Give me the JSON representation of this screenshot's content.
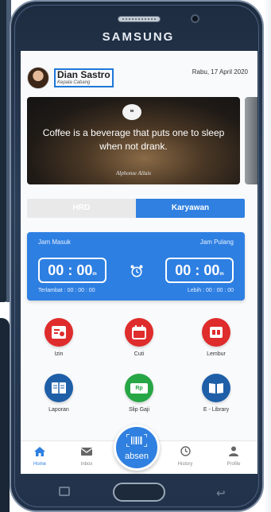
{
  "device": {
    "brand": "SAMSUNG"
  },
  "header": {
    "user_name": "Dian Sastro",
    "user_role": "Kepala Cabang",
    "date": "Rabu, 17 April 2020"
  },
  "quote": {
    "text": "Coffee is a beverage that puts one to sleep when not drank.",
    "author": "Alphonse Allais"
  },
  "tabs": [
    {
      "label": "HRD",
      "active": false
    },
    {
      "label": "Karyawan",
      "active": true
    }
  ],
  "attendance": {
    "in_label": "Jam Masuk",
    "out_label": "Jam Pulang",
    "in_time": "00 : 00",
    "in_suffix": "m",
    "out_time": "00 : 00",
    "out_suffix": "m",
    "late": "Terlambat : 00 : 00 : 00",
    "overtime": "Lebih : 00 : 00 : 00"
  },
  "menu": [
    {
      "label": "Izin",
      "icon": "permit-icon",
      "color": "#df2c2c"
    },
    {
      "label": "Cuti",
      "icon": "calendar-icon",
      "color": "#df2c2c"
    },
    {
      "label": "Lembur",
      "icon": "overtime-icon",
      "color": "#df2c2c"
    },
    {
      "label": "Laporan",
      "icon": "report-icon",
      "color": "#1e5fa8"
    },
    {
      "label": "Slip Gaji",
      "icon": "payslip-icon",
      "color": "#27a645",
      "badge": "Rp"
    },
    {
      "label": "E - Library",
      "icon": "book-icon",
      "color": "#1e5fa8"
    }
  ],
  "nav": [
    {
      "label": "Home",
      "icon": "home-icon",
      "active": true
    },
    {
      "label": "Inbox",
      "icon": "mail-icon",
      "active": false
    },
    {
      "label": "History",
      "icon": "clock-icon",
      "active": false
    },
    {
      "label": "Profile",
      "icon": "user-icon",
      "active": false
    }
  ],
  "absen": {
    "label": "absen",
    "icon": "barcode-icon"
  },
  "colors": {
    "primary": "#2f80e0",
    "red": "#df2c2c",
    "navy": "#1e5fa8",
    "green": "#27a645"
  }
}
